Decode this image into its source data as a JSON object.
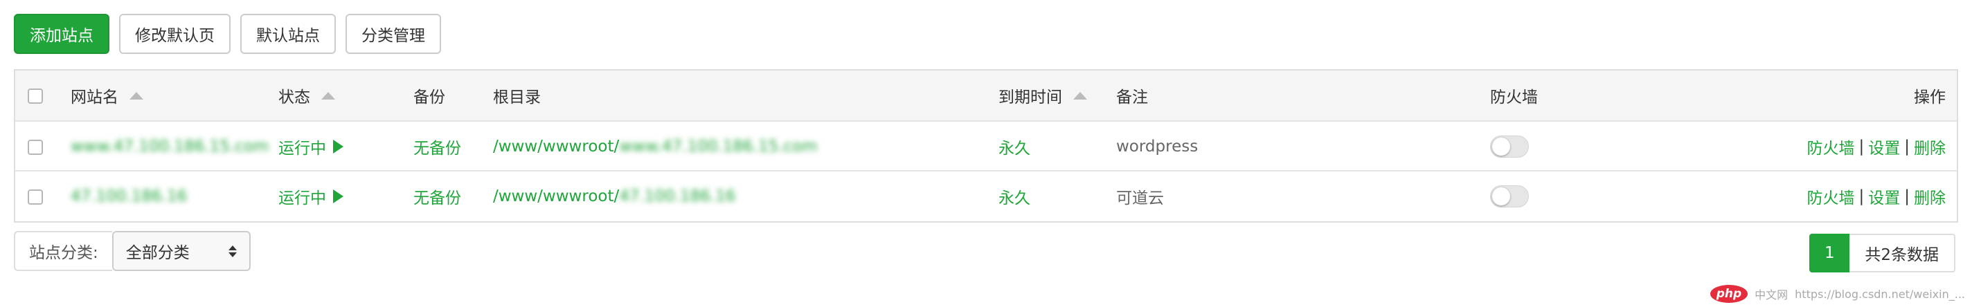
{
  "toolbar": {
    "add_site": "添加站点",
    "edit_default_page": "修改默认页",
    "default_site": "默认站点",
    "category_manage": "分类管理"
  },
  "table": {
    "headers": {
      "site_name": "网站名",
      "status": "状态",
      "backup": "备份",
      "root_dir": "根目录",
      "expire_time": "到期时间",
      "remark": "备注",
      "firewall": "防火墙",
      "actions": "操作"
    },
    "rows": [
      {
        "site_name": "www.47.100.186.15.com",
        "status": "运行中",
        "backup": "无备份",
        "root_dir": "/www/wwwroot/",
        "root_dir_suffix": "www.47.100.186.15.com",
        "expire": "永久",
        "remark": "wordpress",
        "firewall_on": false,
        "action_firewall": "防火墙",
        "action_settings": "设置",
        "action_delete": "删除"
      },
      {
        "site_name": "47.100.186.16",
        "status": "运行中",
        "backup": "无备份",
        "root_dir": "/www/wwwroot/",
        "root_dir_suffix": "47.100.186.16",
        "expire": "永久",
        "remark": "可道云",
        "firewall_on": false,
        "action_firewall": "防火墙",
        "action_settings": "设置",
        "action_delete": "删除"
      }
    ]
  },
  "footer": {
    "category_label": "站点分类:",
    "category_selected": "全部分类",
    "current_page": "1",
    "total_text": "共2条数据"
  },
  "watermark": {
    "logo": "php",
    "site": "中文网",
    "url": "https://blog.csdn.net/weixin_..."
  },
  "colors": {
    "primary": "#20a53a",
    "border": "#dddddd",
    "header_bg": "#f5f5f5"
  }
}
